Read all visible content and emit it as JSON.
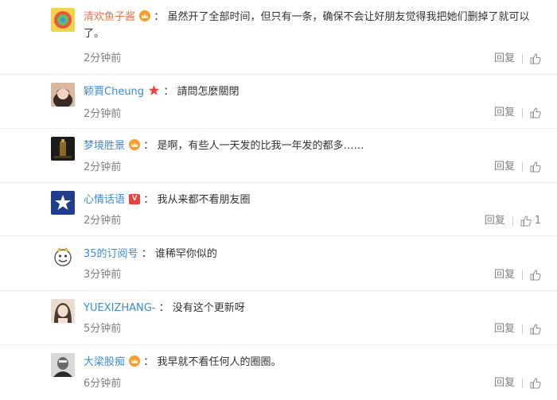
{
  "comments": [
    {
      "user": "清欢鱼子酱",
      "badge": "crown",
      "colon": "：",
      "text": "虽然开了全部时间，但只有一条，确保不会让好朋友觉得我把她们删掉了就可以了。",
      "time": "2分钟前",
      "reply": "回复",
      "likes": ""
    },
    {
      "user": "颖賈Cheung",
      "badge": "star",
      "colon": "：",
      "text": "請問怎麼關閉",
      "time": "2分钟前",
      "reply": "回复",
      "likes": ""
    },
    {
      "user": "梦境胜景",
      "badge": "crown",
      "colon": "：",
      "text": "是啊，有些人一天发的比我一年发的都多……",
      "time": "2分钟前",
      "reply": "回复",
      "likes": ""
    },
    {
      "user": "心情话语",
      "badge": "vip",
      "colon": "：",
      "text": "我从来都不看朋友圈",
      "time": "2分钟前",
      "reply": "回复",
      "likes": "1"
    },
    {
      "user": "35的订阅号",
      "badge": "",
      "colon": "：",
      "text": "谁稀罕你似的",
      "time": "3分钟前",
      "reply": "回复",
      "likes": ""
    },
    {
      "user": "YUEXIZHANG-",
      "badge": "",
      "colon": "：",
      "text": "没有这个更新呀",
      "time": "5分钟前",
      "reply": "回复",
      "likes": ""
    },
    {
      "user": "大梁股痴",
      "badge": "crown",
      "colon": "：",
      "text": "我早就不看任何人的圈圈。",
      "time": "6分钟前",
      "reply": "回复",
      "likes": ""
    }
  ],
  "colors": {
    "username": "#eb7350",
    "meta": "#808080",
    "text": "#333333",
    "divider": "#eeeeee"
  }
}
